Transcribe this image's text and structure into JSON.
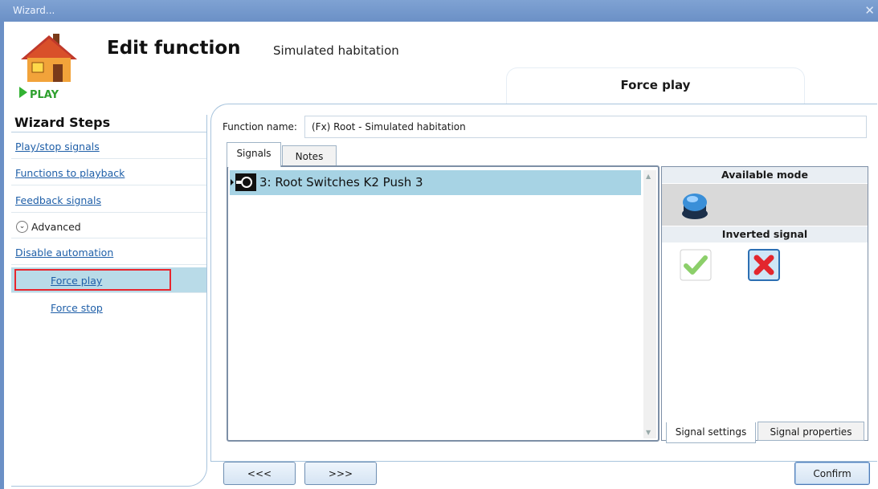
{
  "window": {
    "title": "Wizard...",
    "close_glyph": "✕"
  },
  "header": {
    "title": "Edit function",
    "subtitle": "Simulated habitation",
    "logo_caption": "PLAY",
    "active_step_tab": "Force play"
  },
  "sidebar": {
    "heading": "Wizard Steps",
    "steps": [
      {
        "label": "Play/stop signals"
      },
      {
        "label": "Functions to playback"
      },
      {
        "label": "Feedback signals"
      },
      {
        "label": "Advanced",
        "expander_glyph": "⌄"
      },
      {
        "label": "Disable automation"
      },
      {
        "label": "Force play",
        "selected": true
      },
      {
        "label": "Force stop"
      }
    ]
  },
  "form": {
    "function_name_label": "Function name:",
    "function_name_value": "(Fx) Root - Simulated habitation"
  },
  "tabs": [
    {
      "label": "Signals",
      "active": true
    },
    {
      "label": "Notes",
      "active": false
    }
  ],
  "signals": [
    {
      "label": "3: Root Switches K2 Push 3",
      "selected": true,
      "icon": "push-button-signal-icon"
    }
  ],
  "properties": {
    "available_mode_heading": "Available mode",
    "mode_icon": "blue-push-button-icon",
    "inverted_signal_heading": "Inverted signal",
    "inverted_options": [
      {
        "icon": "green-check-icon",
        "selected": false
      },
      {
        "icon": "red-x-icon",
        "selected": true
      }
    ],
    "bottom_tabs": [
      {
        "label": "Signal settings",
        "active": true
      },
      {
        "label": "Signal properties",
        "active": false
      }
    ]
  },
  "footer": {
    "back_label": "<<<",
    "next_label": ">>>",
    "confirm_label": "Confirm"
  },
  "colors": {
    "titlebar": "#6b90c6",
    "selection": "#a7d3e4",
    "link": "#1f5fa8",
    "highlight_box": "#e8262d"
  }
}
